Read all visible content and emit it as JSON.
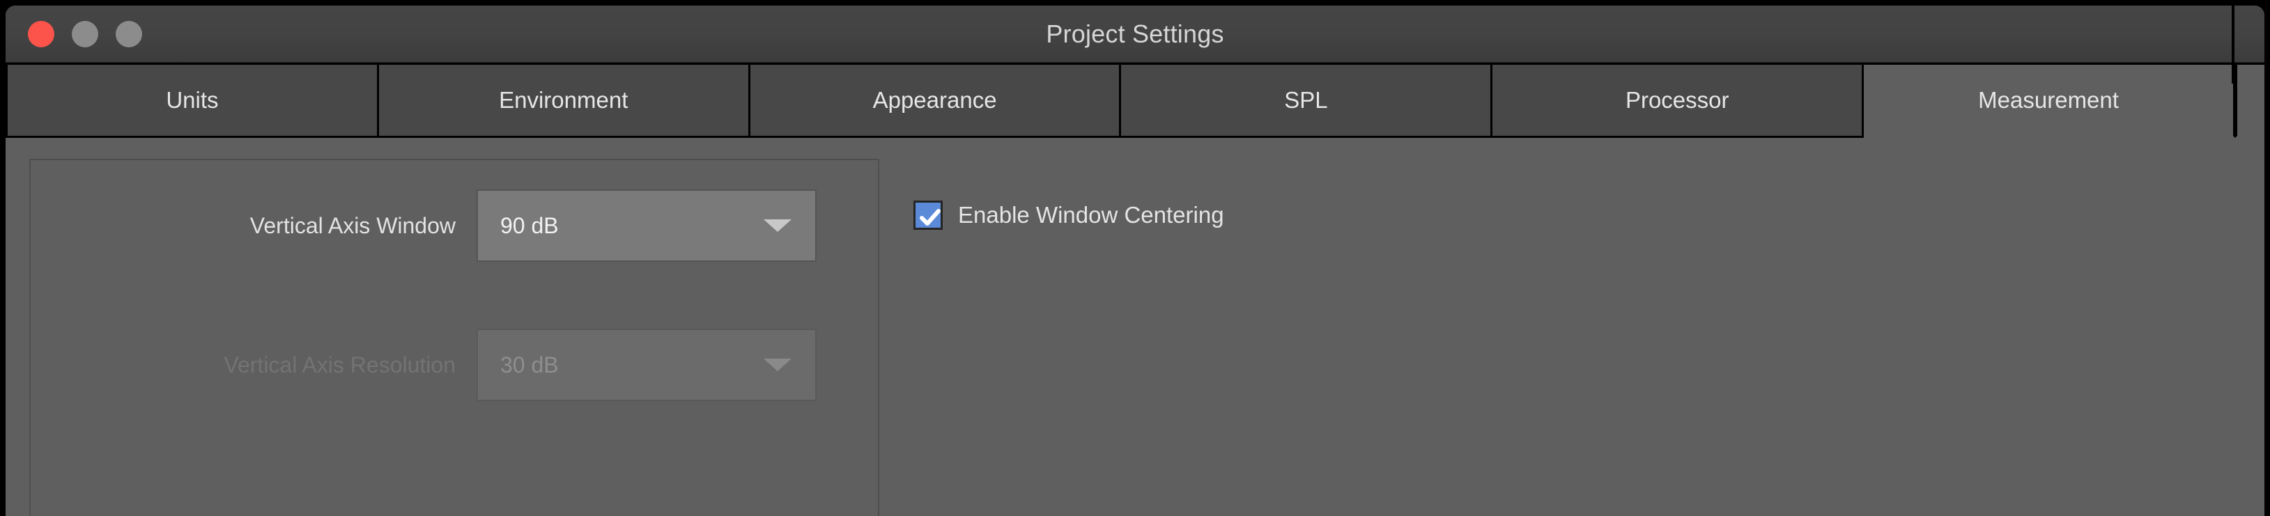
{
  "window": {
    "title": "Project Settings",
    "controls": [
      {
        "name": "close",
        "color": "#fc544b"
      },
      {
        "name": "minimize",
        "color": "#8c8c8c"
      },
      {
        "name": "maximize",
        "color": "#8c8c8c"
      }
    ]
  },
  "tabs": [
    {
      "label": "Units",
      "active": false
    },
    {
      "label": "Environment",
      "active": false
    },
    {
      "label": "Appearance",
      "active": false
    },
    {
      "label": "SPL",
      "active": false
    },
    {
      "label": "Processor",
      "active": false
    },
    {
      "label": "Measurement",
      "active": true
    }
  ],
  "panel": {
    "fields": [
      {
        "label": "Vertical Axis Window",
        "value": "90 dB",
        "enabled": true,
        "options": [
          "90 dB"
        ]
      },
      {
        "label": "Vertical Axis Resolution",
        "value": "30 dB",
        "enabled": false,
        "options": [
          "30 dB"
        ]
      }
    ],
    "checkbox": {
      "label": "Enable Window Centering",
      "checked": true,
      "accent": "#5b8ad8"
    }
  }
}
